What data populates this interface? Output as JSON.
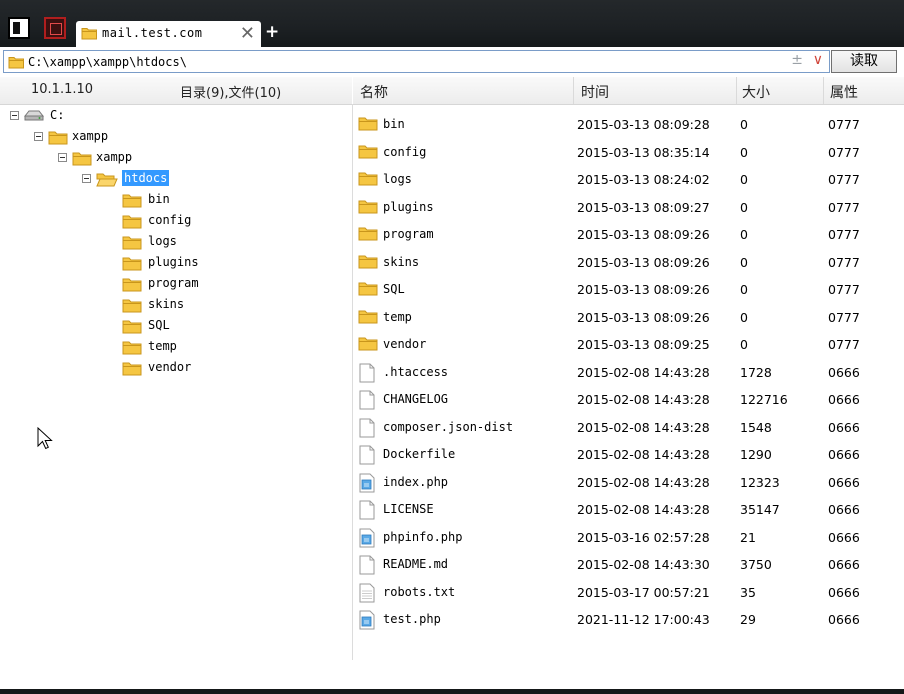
{
  "colors": {
    "accent": "#3399ff",
    "folder": "#f5c642",
    "dropdown": "#d0453a"
  },
  "tab": {
    "title": "mail.test.com"
  },
  "address": {
    "path": "C:\\xampp\\xampp\\htdocs\\",
    "pm": "±",
    "dropdown": "∨",
    "read_label": "读取"
  },
  "left": {
    "ip": "10.1.1.10",
    "count": "目录(9),文件(10)",
    "tree": {
      "drive": "C:",
      "xampp1": "xampp",
      "xampp2": "xampp",
      "htdocs": "htdocs",
      "children": [
        "bin",
        "config",
        "logs",
        "plugins",
        "program",
        "skins",
        "SQL",
        "temp",
        "vendor"
      ]
    }
  },
  "right": {
    "headers": {
      "name": "名称",
      "time": "时间",
      "size": "大小",
      "attr": "属性"
    },
    "rows": [
      {
        "icon": "folder-icon",
        "name": "bin",
        "time": "2015-03-13 08:09:28",
        "size": "0",
        "attr": "0777"
      },
      {
        "icon": "folder-icon",
        "name": "config",
        "time": "2015-03-13 08:35:14",
        "size": "0",
        "attr": "0777"
      },
      {
        "icon": "folder-icon",
        "name": "logs",
        "time": "2015-03-13 08:24:02",
        "size": "0",
        "attr": "0777"
      },
      {
        "icon": "folder-icon",
        "name": "plugins",
        "time": "2015-03-13 08:09:27",
        "size": "0",
        "attr": "0777"
      },
      {
        "icon": "folder-icon",
        "name": "program",
        "time": "2015-03-13 08:09:26",
        "size": "0",
        "attr": "0777"
      },
      {
        "icon": "folder-icon",
        "name": "skins",
        "time": "2015-03-13 08:09:26",
        "size": "0",
        "attr": "0777"
      },
      {
        "icon": "folder-icon",
        "name": "SQL",
        "time": "2015-03-13 08:09:26",
        "size": "0",
        "attr": "0777"
      },
      {
        "icon": "folder-icon",
        "name": "temp",
        "time": "2015-03-13 08:09:26",
        "size": "0",
        "attr": "0777"
      },
      {
        "icon": "folder-icon",
        "name": "vendor",
        "time": "2015-03-13 08:09:25",
        "size": "0",
        "attr": "0777"
      },
      {
        "icon": "file-icon",
        "name": ".htaccess",
        "time": "2015-02-08 14:43:28",
        "size": "1728",
        "attr": "0666"
      },
      {
        "icon": "file-icon",
        "name": "CHANGELOG",
        "time": "2015-02-08 14:43:28",
        "size": "122716",
        "attr": "0666"
      },
      {
        "icon": "file-icon",
        "name": "composer.json-dist",
        "time": "2015-02-08 14:43:28",
        "size": "1548",
        "attr": "0666"
      },
      {
        "icon": "file-icon",
        "name": "Dockerfile",
        "time": "2015-02-08 14:43:28",
        "size": "1290",
        "attr": "0666"
      },
      {
        "icon": "php-file-icon",
        "name": "index.php",
        "time": "2015-02-08 14:43:28",
        "size": "12323",
        "attr": "0666"
      },
      {
        "icon": "file-icon",
        "name": "LICENSE",
        "time": "2015-02-08 14:43:28",
        "size": "35147",
        "attr": "0666"
      },
      {
        "icon": "php-file-icon",
        "name": "phpinfo.php",
        "time": "2015-03-16 02:57:28",
        "size": "21",
        "attr": "0666"
      },
      {
        "icon": "file-icon",
        "name": "README.md",
        "time": "2015-02-08 14:43:30",
        "size": "3750",
        "attr": "0666"
      },
      {
        "icon": "text-file-icon",
        "name": "robots.txt",
        "time": "2015-03-17 00:57:21",
        "size": "35",
        "attr": "0666"
      },
      {
        "icon": "php-file-icon",
        "name": "test.php",
        "time": "2021-11-12 17:00:43",
        "size": "29",
        "attr": "0666"
      }
    ]
  }
}
